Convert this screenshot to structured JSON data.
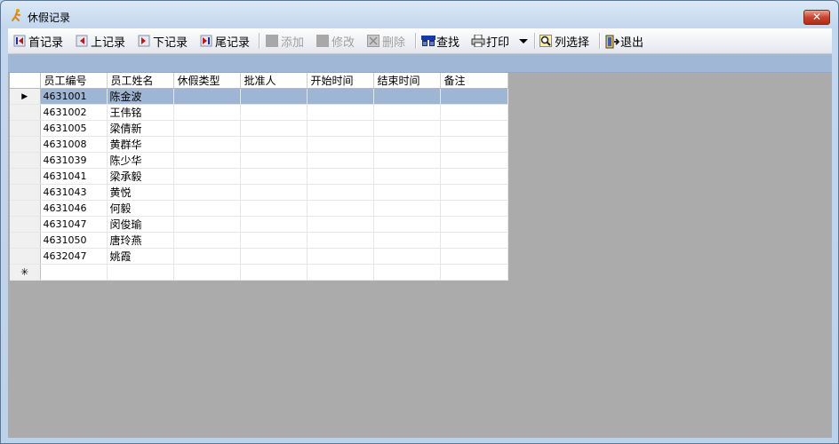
{
  "window": {
    "title": "休假记录",
    "close": "✕"
  },
  "toolbar": {
    "first": "首记录",
    "prev": "上记录",
    "next": "下记录",
    "last": "尾记录",
    "add": "添加",
    "edit": "修改",
    "delete": "删除",
    "find": "查找",
    "print": "打印",
    "columns": "列选择",
    "exit": "退出"
  },
  "table": {
    "columns": [
      "员工编号",
      "员工姓名",
      "休假类型",
      "批准人",
      "开始时间",
      "结束时间",
      "备注"
    ],
    "current_marker": "▶",
    "new_row_marker": "✳",
    "rows": [
      [
        "4631001",
        "陈金波",
        "",
        "",
        "",
        "",
        ""
      ],
      [
        "4631002",
        "王伟铭",
        "",
        "",
        "",
        "",
        ""
      ],
      [
        "4631005",
        "梁倩新",
        "",
        "",
        "",
        "",
        ""
      ],
      [
        "4631008",
        "黄群华",
        "",
        "",
        "",
        "",
        ""
      ],
      [
        "4631039",
        "陈少华",
        "",
        "",
        "",
        "",
        ""
      ],
      [
        "4631041",
        "梁承毅",
        "",
        "",
        "",
        "",
        ""
      ],
      [
        "4631043",
        "黄悦",
        "",
        "",
        "",
        "",
        ""
      ],
      [
        "4631046",
        "何毅",
        "",
        "",
        "",
        "",
        ""
      ],
      [
        "4631047",
        "闵俊瑜",
        "",
        "",
        "",
        "",
        ""
      ],
      [
        "4631050",
        "唐玲燕",
        "",
        "",
        "",
        "",
        ""
      ],
      [
        "4632047",
        "姚霞",
        "",
        "",
        "",
        "",
        ""
      ]
    ]
  }
}
